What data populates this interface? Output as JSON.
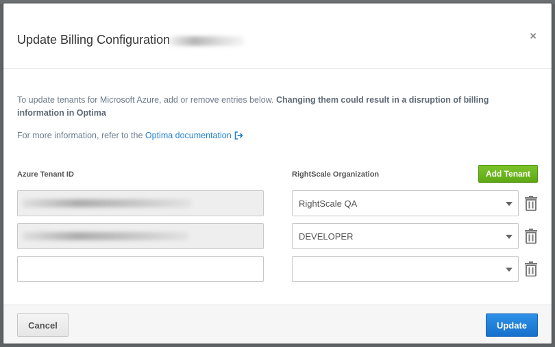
{
  "modal": {
    "title": "Update Billing Configuration",
    "close_label": "×"
  },
  "info": {
    "text_plain": "To update tenants for Microsoft Azure, add or remove entries below. ",
    "text_bold": "Changing them could result in a disruption of billing information in Optima",
    "more_prefix": "For more information, refer to the ",
    "doc_link": "Optima documentation",
    "link_color": "#1c7fd1"
  },
  "table": {
    "tenant_header": "Azure Tenant ID",
    "org_header": "RightScale Organization",
    "add_button": "Add Tenant",
    "rows": [
      {
        "tenant_id": "",
        "organization": "RightScale QA"
      },
      {
        "tenant_id": "",
        "organization": "DEVELOPER"
      },
      {
        "tenant_id": "",
        "organization": ""
      }
    ]
  },
  "footer": {
    "cancel_label": "Cancel",
    "update_label": "Update"
  },
  "colors": {
    "add_button": "#6ab41c",
    "update_button": "#1c7fd1"
  }
}
